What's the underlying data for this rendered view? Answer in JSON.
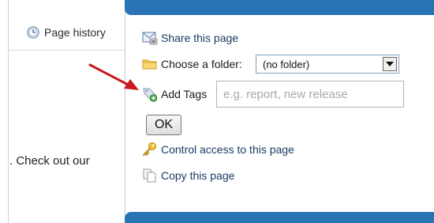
{
  "background_page": {
    "page_history_label": "Page history",
    "body_fragment": ". Check out our"
  },
  "share_menu": {
    "share_label": "Share this page",
    "folder_label": "Choose a folder:",
    "folder_select": {
      "selected": "(no folder)"
    },
    "tags_label": "Add Tags",
    "tags_input": {
      "value": "",
      "placeholder": "e.g. report, new release"
    },
    "ok_label": "OK",
    "control_access_label": "Control access to this page",
    "copy_label": "Copy this page"
  },
  "icons": {
    "page_history": "clock-icon",
    "share": "envelope-icon",
    "folder": "folder-icon",
    "tags": "tag-add-icon",
    "control_access": "key-icon",
    "copy": "copy-icon",
    "dropdown": "chevron-down-icon"
  },
  "colors": {
    "accent_bar": "#2a73b5",
    "annotation_arrow": "#c8191e"
  }
}
